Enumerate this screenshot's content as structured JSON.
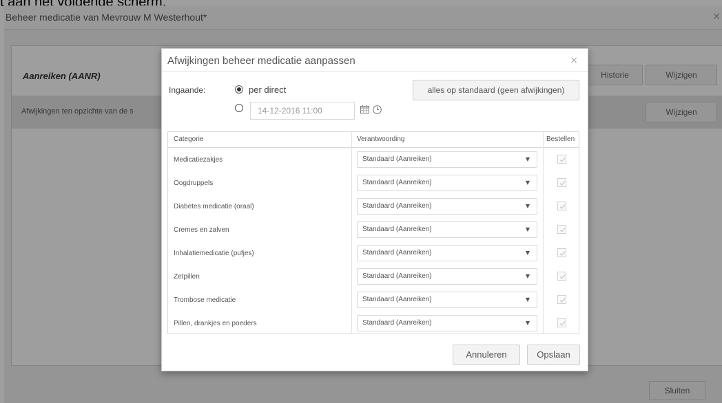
{
  "top_fragment": "t aan het volgende scherm.",
  "window": {
    "title": "Beheer medicatie van Mevrouw M Westerhout*",
    "close_glyph": "×"
  },
  "panel": {
    "heading": "Aanreiken (AANR)",
    "historie_label": "Historie",
    "wijzigen_label": "Wijzigen",
    "row_text": "Afwijkingen ten opzichte van de s",
    "row_wijzigen_label": "Wijzigen",
    "sluiten_label": "Sluiten"
  },
  "modal": {
    "title": "Afwijkingen beheer medicatie aanpassen",
    "close_glyph": "×",
    "ingaande_label": "Ingaande:",
    "per_direct_label": "per direct",
    "date_value": "14-12-2016 11:00",
    "standaard_button": "alles op standaard (geen afwijkingen)",
    "columns": {
      "categorie": "Categorie",
      "verantwoording": "Verantwoording",
      "bestellen": "Bestellen"
    },
    "rows": [
      {
        "categorie": "Medicatiezakjes",
        "verantwoording": "Standaard (Aanreiken)",
        "bestellen": true
      },
      {
        "categorie": "Oogdruppels",
        "verantwoording": "Standaard (Aanreiken)",
        "bestellen": true
      },
      {
        "categorie": "Diabetes medicatie (oraal)",
        "verantwoording": "Standaard (Aanreiken)",
        "bestellen": true
      },
      {
        "categorie": "Cremes en zalven",
        "verantwoording": "Standaard (Aanreiken)",
        "bestellen": true
      },
      {
        "categorie": "Inhalatiemedicatie (pufjes)",
        "verantwoording": "Standaard (Aanreiken)",
        "bestellen": true
      },
      {
        "categorie": "Zetpillen",
        "verantwoording": "Standaard (Aanreiken)",
        "bestellen": true
      },
      {
        "categorie": "Trombose medicatie",
        "verantwoording": "Standaard (Aanreiken)",
        "bestellen": true
      },
      {
        "categorie": "Pillen, drankjes en poeders",
        "verantwoording": "Standaard (Aanreiken)",
        "bestellen": true
      }
    ],
    "annuleren_label": "Annuleren",
    "opslaan_label": "Opslaan",
    "dropdown_arrow": "▼"
  }
}
